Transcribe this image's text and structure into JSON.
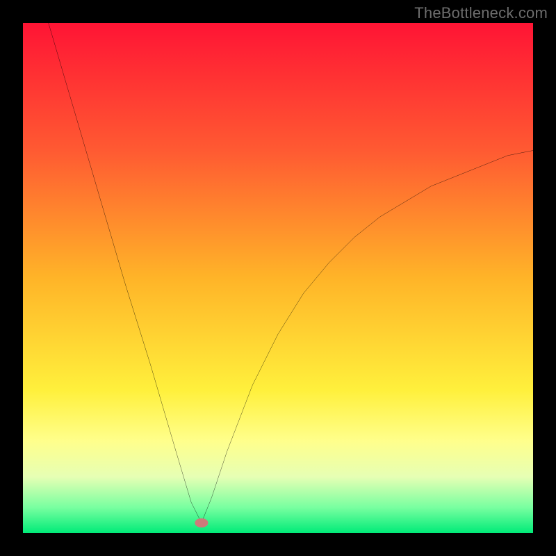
{
  "watermark": "TheBottleneck.com",
  "chart_data": {
    "type": "line",
    "title": "",
    "xlabel": "",
    "ylabel": "",
    "xlim": [
      0,
      100
    ],
    "ylim": [
      0,
      100
    ],
    "grid": false,
    "background": "heatmap-gradient",
    "vertex": {
      "x": 35,
      "y": 2,
      "marker": "ellipse",
      "color": "#cd7a7a"
    },
    "series": [
      {
        "name": "left-branch",
        "x": [
          5,
          10,
          15,
          20,
          25,
          30,
          33,
          35
        ],
        "values": [
          100,
          83,
          66,
          49,
          33,
          16,
          6,
          2
        ]
      },
      {
        "name": "right-branch",
        "x": [
          35,
          37,
          40,
          45,
          50,
          55,
          60,
          65,
          70,
          75,
          80,
          85,
          90,
          95,
          100
        ],
        "values": [
          2,
          7,
          16,
          29,
          39,
          47,
          53,
          58,
          62,
          65,
          68,
          70,
          72,
          74,
          75
        ]
      }
    ]
  }
}
